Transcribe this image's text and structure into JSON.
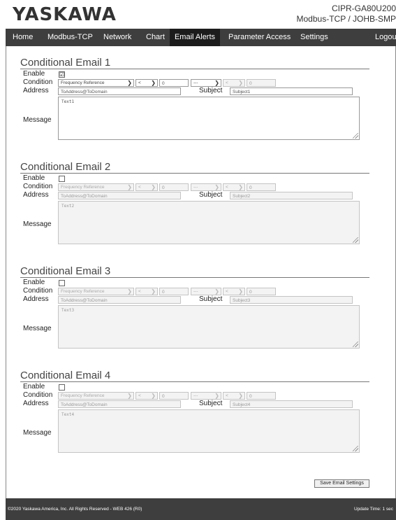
{
  "brand": "YASKAWA",
  "model": [
    "CIPR-GA80U200",
    "Modbus-TCP / JOHB-SMP"
  ],
  "nav": [
    "Home",
    "Modbus-TCP",
    "Network",
    "Chart",
    "Email Alerts",
    "Parameter Access",
    "Settings",
    "Logout"
  ],
  "active_tab": "Email Alerts",
  "labels": {
    "enable": "Enable",
    "condition": "Condition",
    "address": "Address",
    "subject": "Subject",
    "message": "Message"
  },
  "emails": [
    {
      "title": "Conditional Email 1",
      "enabled": "☑",
      "param": "Frequency Reference",
      "op1": "<",
      "value1": "0",
      "logic": "---",
      "op2": "<",
      "value2": "0",
      "address": "ToAddress@ToDomain",
      "subject": "Subject1",
      "message": "Text1"
    },
    {
      "title": "Conditional Email 2",
      "enabled": "",
      "param": "Frequency Reference",
      "op1": "<",
      "value1": "0",
      "logic": "---",
      "op2": "<",
      "value2": "0",
      "address": "ToAddress@ToDomain",
      "subject": "Subject2",
      "message": "Text2"
    },
    {
      "title": "Conditional Email 3",
      "enabled": "",
      "param": "Frequency Reference",
      "op1": "<",
      "value1": "0",
      "logic": "---",
      "op2": "<",
      "value2": "0",
      "address": "ToAddress@ToDomain",
      "subject": "Subject3",
      "message": "Text3"
    },
    {
      "title": "Conditional Email 4",
      "enabled": "",
      "param": "Frequency Reference",
      "op1": "<",
      "value1": "0",
      "logic": "---",
      "op2": "<",
      "value2": "0",
      "address": "ToAddress@ToDomain",
      "subject": "Subject4",
      "message": "Text4"
    }
  ],
  "save_label": "Save Email Settings",
  "footer": {
    "copyright": "©2020 Yaskawa America, Inc. All Rights Reserved - WEB 426 (R0)",
    "update": "Update Time: 1 sec"
  }
}
